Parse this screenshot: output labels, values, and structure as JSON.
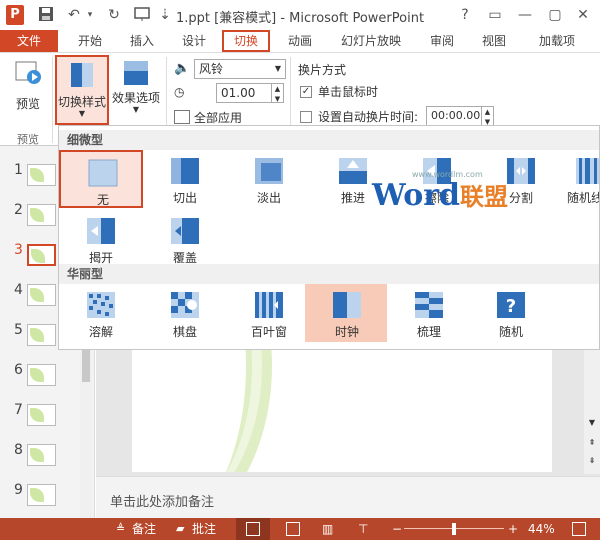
{
  "window": {
    "title": "1.ppt [兼容模式] - Microsoft PowerPoint",
    "controls": [
      "?",
      "▭",
      "—",
      "▢",
      "✕"
    ]
  },
  "tabs": [
    "文件",
    "开始",
    "插入",
    "设计",
    "切换",
    "动画",
    "幻灯片放映",
    "审阅",
    "视图",
    "加载项"
  ],
  "ribbon": {
    "preview_label": "预览",
    "preview_group": "预览",
    "transition_style_label": "切换样式",
    "effect_options_label": "效果选项",
    "sound_value": "风铃",
    "duration_value": "01.00",
    "apply_all_label": "全部应用",
    "advance_title": "换片方式",
    "on_click_label": "单击鼠标时",
    "on_click_checked": true,
    "auto_after_label": "设置自动换片时间:",
    "auto_after_checked": false,
    "auto_after_value": "00:00.00"
  },
  "gallery": {
    "subtle_header": "细微型",
    "subtle": [
      "无",
      "切出",
      "淡出",
      "推进",
      "擦除",
      "分割",
      "随机线",
      "揭开",
      "覆盖"
    ],
    "exciting_header": "华丽型",
    "exciting": [
      "溶解",
      "棋盘",
      "百叶窗",
      "时钟",
      "梳理",
      "随机"
    ]
  },
  "slides": [
    "1",
    "2",
    "3",
    "4",
    "5",
    "6",
    "7",
    "8",
    "9"
  ],
  "selected_slide": "3",
  "notes_placeholder": "单击此处添加备注",
  "status": {
    "notes": "备注",
    "comments": "批注",
    "zoom": "44%"
  },
  "watermark": {
    "word": "Word",
    "brand": "联盟",
    "site": "www.wordlm.com"
  },
  "colors": {
    "accent": "#d24726",
    "statusbar": "#b7472a"
  }
}
